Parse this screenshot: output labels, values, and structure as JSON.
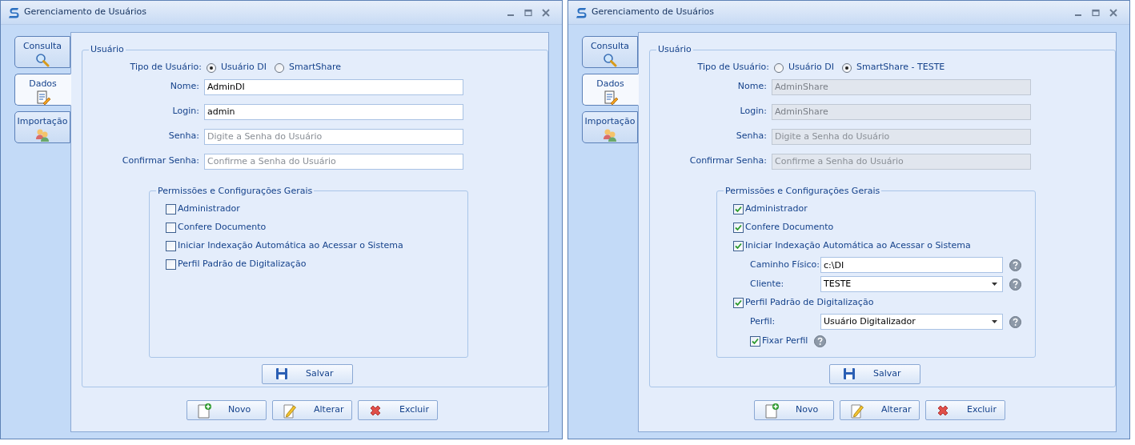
{
  "windows": [
    {
      "title": "Gerenciamento de Usuários",
      "tabs": [
        {
          "label": "Consulta",
          "selected": false
        },
        {
          "label": "Dados",
          "selected": true
        },
        {
          "label": "Importação",
          "selected": false
        }
      ],
      "user_group": {
        "title": "Usuário",
        "type_label": "Tipo de Usuário:",
        "types": [
          {
            "label": "Usuário DI",
            "selected": true
          },
          {
            "label": "SmartShare",
            "selected": false
          }
        ],
        "fields": [
          {
            "label": "Nome:",
            "value": "AdminDI",
            "disabled": false
          },
          {
            "label": "Login:",
            "value": "admin",
            "disabled": false
          },
          {
            "label": "Senha:",
            "placeholder": "Digite a Senha do Usuário",
            "disabled": false
          },
          {
            "label": "Confirmar Senha:",
            "placeholder": "Confirme a Senha do Usuário",
            "disabled": false
          }
        ],
        "permissions": {
          "title": "Permissões e Configurações Gerais",
          "items": [
            {
              "kind": "checkbox",
              "label": "Administrador",
              "checked": false
            },
            {
              "kind": "checkbox",
              "label": "Confere Documento",
              "checked": false
            },
            {
              "kind": "checkbox",
              "label": "Iniciar Indexação Automática ao Acessar o Sistema",
              "checked": false
            },
            {
              "kind": "checkbox",
              "label": "Perfil Padrão de Digitalização",
              "checked": false
            }
          ]
        },
        "save_button": "Salvar"
      },
      "buttons": [
        "Novo",
        "Alterar",
        "Excluir"
      ]
    },
    {
      "title": "Gerenciamento de Usuários",
      "tabs": [
        {
          "label": "Consulta",
          "selected": false
        },
        {
          "label": "Dados",
          "selected": true
        },
        {
          "label": "Importação",
          "selected": false
        }
      ],
      "user_group": {
        "title": "Usuário",
        "type_label": "Tipo de Usuário:",
        "types": [
          {
            "label": "Usuário DI",
            "selected": false
          },
          {
            "label": "SmartShare - TESTE",
            "selected": true
          }
        ],
        "fields": [
          {
            "label": "Nome:",
            "value": "AdminShare",
            "disabled": true
          },
          {
            "label": "Login:",
            "value": "AdminShare",
            "disabled": true
          },
          {
            "label": "Senha:",
            "placeholder": "Digite a Senha do Usuário",
            "disabled": true
          },
          {
            "label": "Confirmar Senha:",
            "placeholder": "Confirme a Senha do Usuário",
            "disabled": true
          }
        ],
        "permissions": {
          "title": "Permissões e Configurações Gerais",
          "items": [
            {
              "kind": "checkbox",
              "label": "Administrador",
              "checked": true
            },
            {
              "kind": "checkbox",
              "label": "Confere Documento",
              "checked": true
            },
            {
              "kind": "checkbox",
              "label": "Iniciar Indexação Automática ao Acessar o Sistema",
              "checked": true,
              "children": [
                {
                  "kind": "text",
                  "label": "Caminho Físico:",
                  "value": "c:\\DI",
                  "help": true
                },
                {
                  "kind": "dropdown",
                  "label": "Cliente:",
                  "value": "TESTE",
                  "help": true
                }
              ]
            },
            {
              "kind": "checkbox",
              "label": "Perfil Padrão de Digitalização",
              "checked": true,
              "children": [
                {
                  "kind": "dropdown",
                  "label": "Perfil:",
                  "value": "Usuário Digitalizador",
                  "help": true
                },
                {
                  "kind": "checkbox",
                  "label": "Fixar Perfil",
                  "checked": true,
                  "help": true
                }
              ]
            }
          ]
        },
        "save_button": "Salvar"
      },
      "buttons": [
        "Novo",
        "Alterar",
        "Excluir"
      ]
    }
  ]
}
